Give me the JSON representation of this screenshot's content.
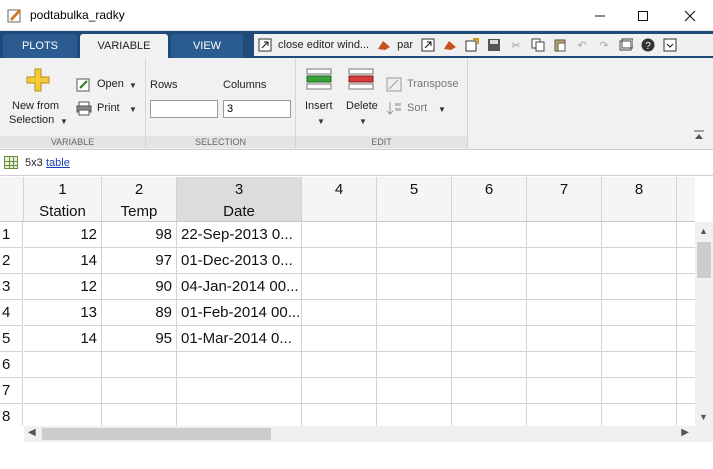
{
  "window": {
    "title": "podtabulka_radky",
    "minimize_icon": "minimize-icon",
    "maximize_icon": "maximize-icon",
    "close_icon": "close-icon"
  },
  "tabs": [
    {
      "label": "PLOTS"
    },
    {
      "label": "VARIABLE"
    },
    {
      "label": "VIEW"
    }
  ],
  "quick_access": {
    "shortcut1_label": "close editor wind...",
    "shortcut2_label": "par"
  },
  "ribbon": {
    "variable_section": {
      "new_from_selection_line1": "New from",
      "new_from_selection_line2": "Selection",
      "open_label": "Open",
      "print_label": "Print",
      "section_label": "VARIABLE"
    },
    "selection_section": {
      "rows_label": "Rows",
      "columns_label": "Columns",
      "rows_value": "",
      "columns_value": "3",
      "section_label": "SELECTION"
    },
    "edit_section": {
      "insert_label": "Insert",
      "delete_label": "Delete",
      "transpose_label": "Transpose",
      "sort_label": "Sort",
      "section_label": "EDIT"
    }
  },
  "variable_info": {
    "size": "5x3",
    "class_link": "table"
  },
  "grid": {
    "columns": [
      {
        "num": "1",
        "name": "Station"
      },
      {
        "num": "2",
        "name": "Temp"
      },
      {
        "num": "3",
        "name": "Date"
      },
      {
        "num": "4",
        "name": ""
      },
      {
        "num": "5",
        "name": ""
      },
      {
        "num": "6",
        "name": ""
      },
      {
        "num": "7",
        "name": ""
      },
      {
        "num": "8",
        "name": ""
      }
    ],
    "row_numbers": [
      "1",
      "2",
      "3",
      "4",
      "5",
      "6",
      "7",
      "8"
    ],
    "rows": [
      {
        "station": "12",
        "temp": "98",
        "date": "22-Sep-2013 0..."
      },
      {
        "station": "14",
        "temp": "97",
        "date": "01-Dec-2013 0..."
      },
      {
        "station": "12",
        "temp": "90",
        "date": "04-Jan-2014 00..."
      },
      {
        "station": "13",
        "temp": "89",
        "date": "01-Feb-2014 00..."
      },
      {
        "station": "14",
        "temp": "95",
        "date": "01-Mar-2014 0..."
      }
    ]
  },
  "colors": {
    "tabstrip": "#1f4a7a",
    "ribbon": "#f1f1f1",
    "selected_column": "#dcdcdc"
  }
}
